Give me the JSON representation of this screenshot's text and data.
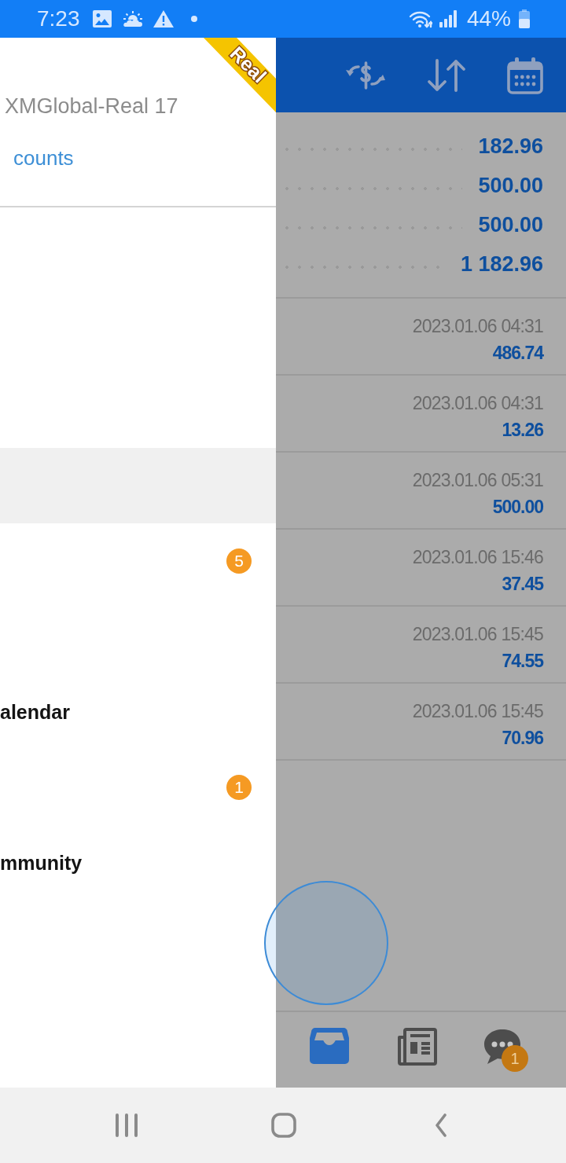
{
  "status_bar": {
    "time": "7:23",
    "battery": "44%"
  },
  "drawer": {
    "ribbon": "Real",
    "server": "XMGlobal-Real 17",
    "link": "counts",
    "items": [
      {
        "selected": true
      },
      {
        "badge": "5",
        "selected": false
      },
      {
        "label": "alendar",
        "selected": false
      },
      {
        "badge": "1",
        "selected": false
      },
      {
        "label": "mmunity",
        "selected": false
      }
    ]
  },
  "balances": [
    "182.96",
    "500.00",
    "500.00",
    "1 182.96"
  ],
  "history": [
    {
      "time": "2023.01.06 04:31",
      "amount": "486.74"
    },
    {
      "time": "2023.01.06 04:31",
      "amount": "13.26"
    },
    {
      "time": "2023.01.06 05:31",
      "amount": "500.00"
    },
    {
      "time": "2023.01.06 15:46",
      "amount": "37.45"
    },
    {
      "time": "2023.01.06 15:45",
      "amount": "74.55"
    },
    {
      "time": "2023.01.06 15:45",
      "amount": "70.96"
    }
  ],
  "bottom_nav": [
    {
      "kind": "inbox",
      "selected": true
    },
    {
      "kind": "news",
      "selected": false
    },
    {
      "kind": "chat",
      "selected": false,
      "badge": "1"
    }
  ]
}
